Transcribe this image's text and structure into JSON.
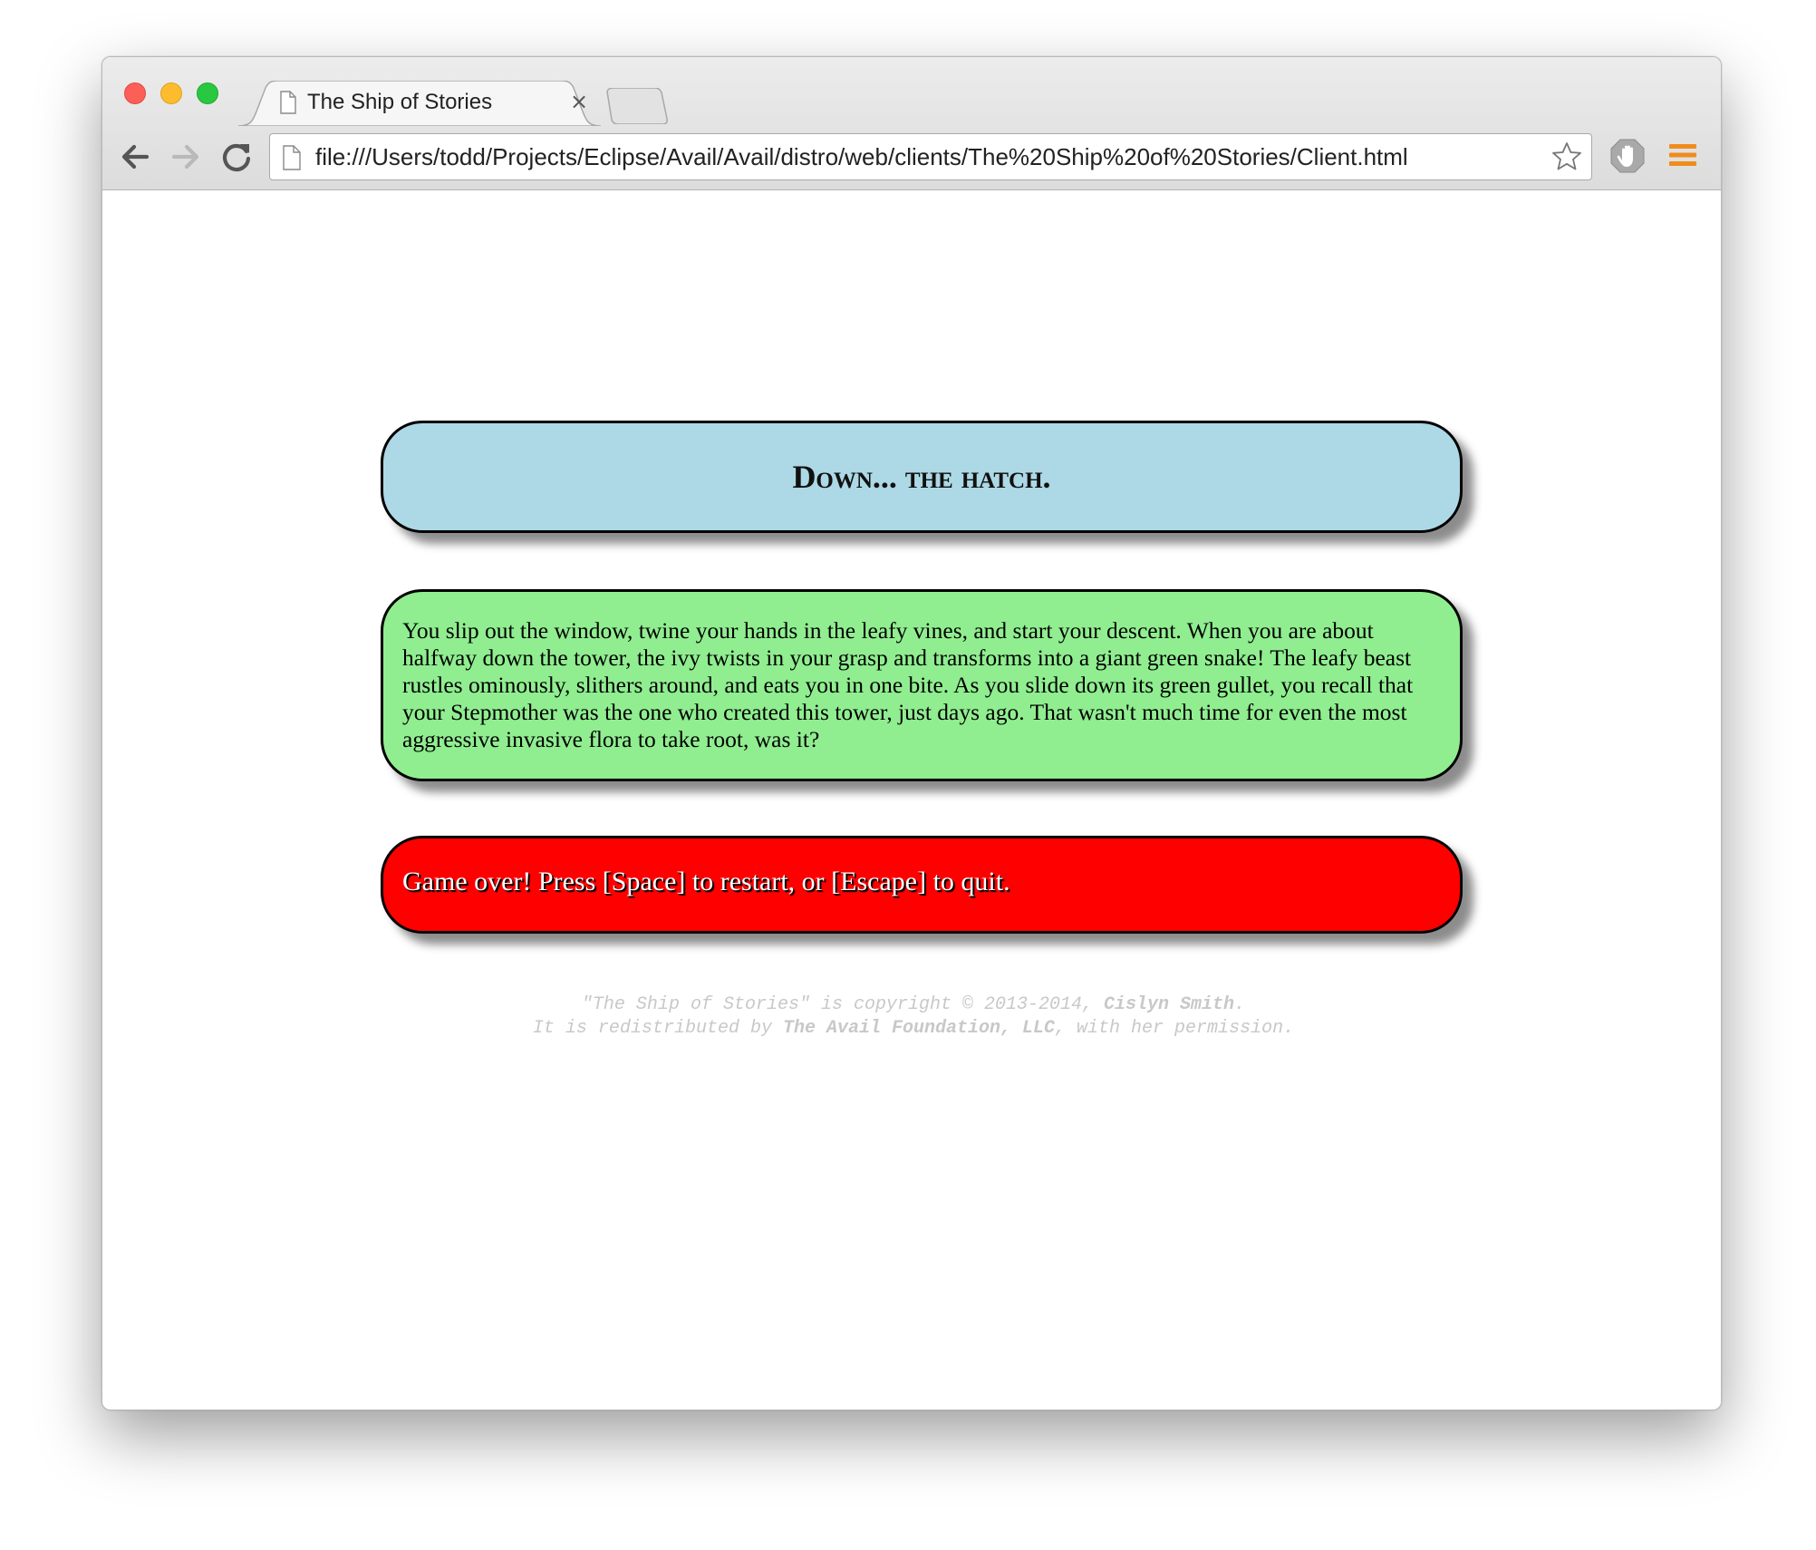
{
  "browser": {
    "tab": {
      "title": "The Ship of Stories",
      "close_glyph": "×"
    },
    "address_bar": {
      "url": "file:///Users/todd/Projects/Eclipse/Avail/Avail/distro/web/clients/The%20Ship%20of%20Stories/Client.html"
    },
    "icons": {
      "back": "back-arrow-icon",
      "forward": "forward-arrow-icon",
      "reload": "reload-icon",
      "bookmark": "star-icon",
      "extension": "hand-stop-icon",
      "menu": "hamburger-menu-icon"
    }
  },
  "page": {
    "title": "Down... the hatch.",
    "story": "You slip out the window, twine your hands in the leafy vines, and start your descent. When you are about halfway down the tower, the ivy twists in your grasp and transforms into a giant green snake! The leafy beast rustles ominously, slithers around, and eats you in one bite. As you slide down its green gullet, you recall that your Stepmother was the one who created this tower, just days ago. That wasn't much time for even the most aggressive invasive flora to take root, was it?",
    "game_over": "Game over! Press [Space] to restart, or [Escape] to quit.",
    "copyright": {
      "line1_prefix": "\"The Ship of Stories\" is copyright © 2013-2014, ",
      "line1_author": "Cislyn Smith",
      "line1_suffix": ".",
      "line2_prefix": "It is redistributed by ",
      "line2_org": "The Avail Foundation, LLC",
      "line2_suffix": ", with her permission."
    }
  },
  "colors": {
    "title_panel": "#add8e6",
    "story_panel": "#90ee90",
    "game_over_panel": "#ff0000",
    "copyright_text": "#c8c8c8"
  }
}
